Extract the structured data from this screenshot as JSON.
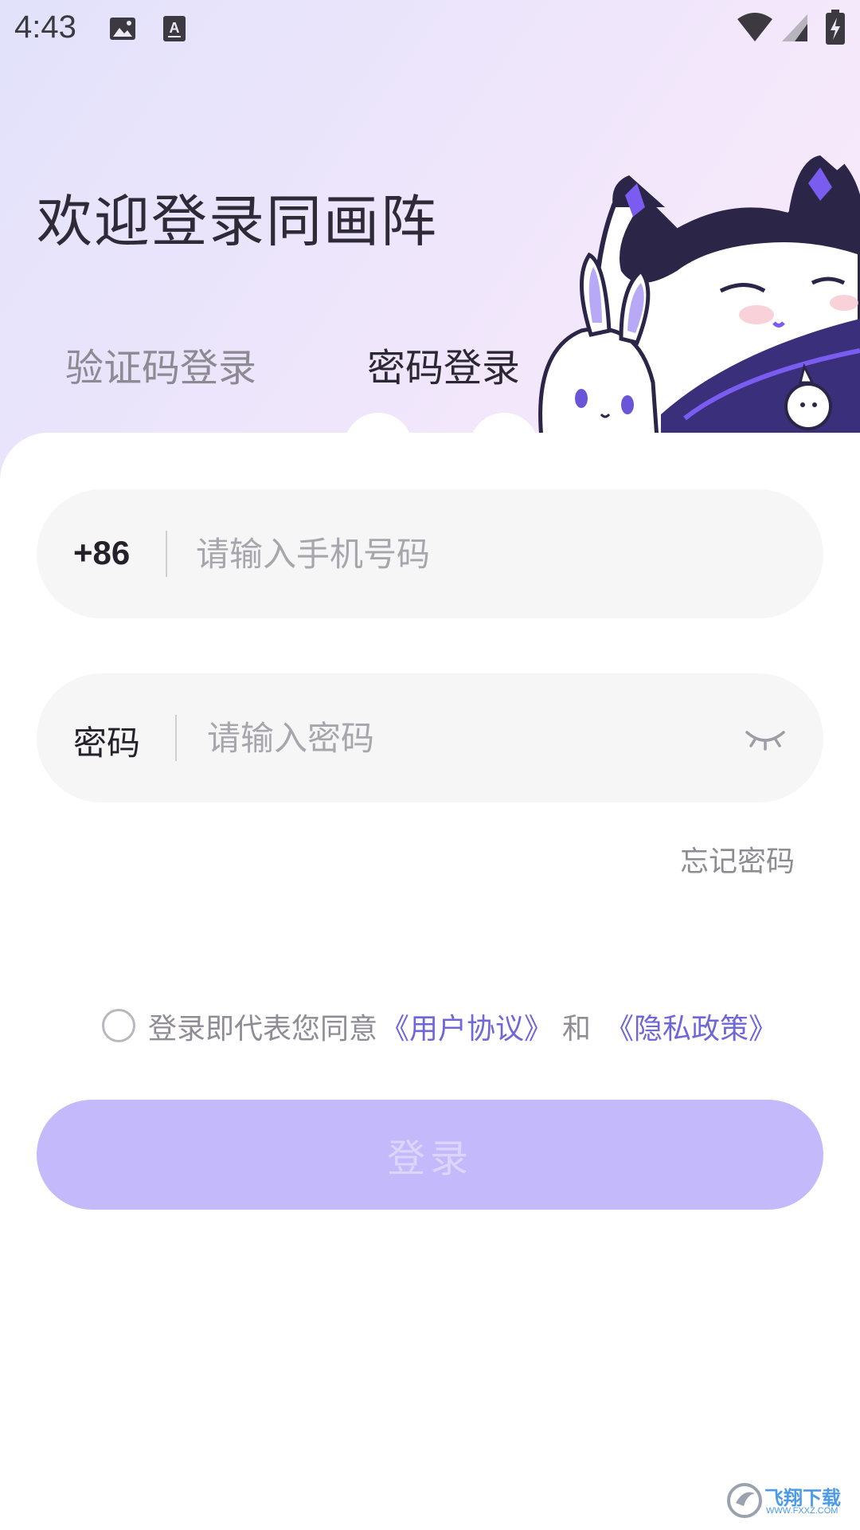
{
  "status_bar": {
    "time": "4:43"
  },
  "header": {
    "title": "欢迎登录同画阵",
    "tabs": [
      {
        "label": "验证码登录",
        "active": false
      },
      {
        "label": "密码登录",
        "active": true
      }
    ]
  },
  "form": {
    "phone": {
      "country_code": "+86",
      "placeholder": "请输入手机号码",
      "value": ""
    },
    "password": {
      "label": "密码",
      "placeholder": "请输入密码",
      "value": ""
    },
    "forgot_label": "忘记密码",
    "agreement": {
      "checked": false,
      "prefix": "登录即代表您同意",
      "user_agreement": "《用户协议》",
      "conjunction": "和",
      "privacy_policy": "《隐私政策》"
    },
    "submit_label": "登录"
  },
  "watermark": {
    "text": "飞翔下载",
    "url": "WWW.FXXZ.COM"
  },
  "colors": {
    "accent": "#6f66d8",
    "button_bg": "#c4b9fb",
    "field_bg": "#f6f6f7",
    "header_gradient_start": "#e2e2fb",
    "header_gradient_end": "#f7ecfb"
  },
  "icons": {
    "status": [
      "image-icon",
      "keyboard-a-icon",
      "wifi-icon",
      "signal-icon",
      "battery-charging-icon"
    ],
    "password_toggle": "eye-closed-icon"
  }
}
